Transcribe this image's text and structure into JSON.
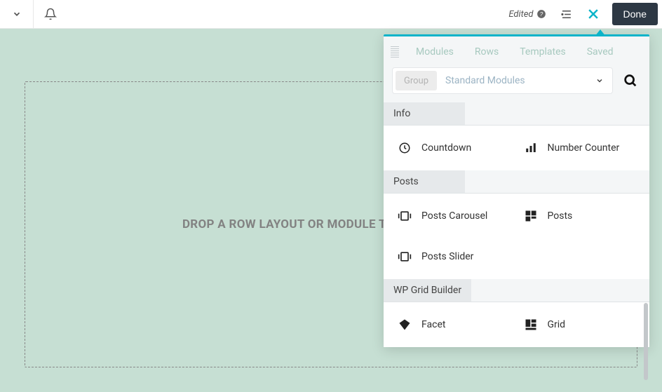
{
  "topbar": {
    "edited": "Edited",
    "done": "Done"
  },
  "canvas": {
    "drop_text": "DROP A ROW LAYOUT OR MODULE TO GET STARTED!"
  },
  "panel": {
    "tabs": {
      "modules": "Modules",
      "rows": "Rows",
      "templates": "Templates",
      "saved": "Saved"
    },
    "filter": {
      "group_label": "Group",
      "select_value": "Standard Modules"
    },
    "sections": [
      {
        "title": "Info",
        "items": [
          {
            "label": "Countdown",
            "icon": "clock"
          },
          {
            "label": "Number Counter",
            "icon": "bars"
          }
        ]
      },
      {
        "title": "Posts",
        "items": [
          {
            "label": "Posts Carousel",
            "icon": "carousel"
          },
          {
            "label": "Posts",
            "icon": "grid3"
          },
          {
            "label": "Posts Slider",
            "icon": "carousel"
          }
        ]
      },
      {
        "title": "WP Grid Builder",
        "items": [
          {
            "label": "Facet",
            "icon": "diamond"
          },
          {
            "label": "Grid",
            "icon": "grid2"
          }
        ]
      }
    ]
  }
}
